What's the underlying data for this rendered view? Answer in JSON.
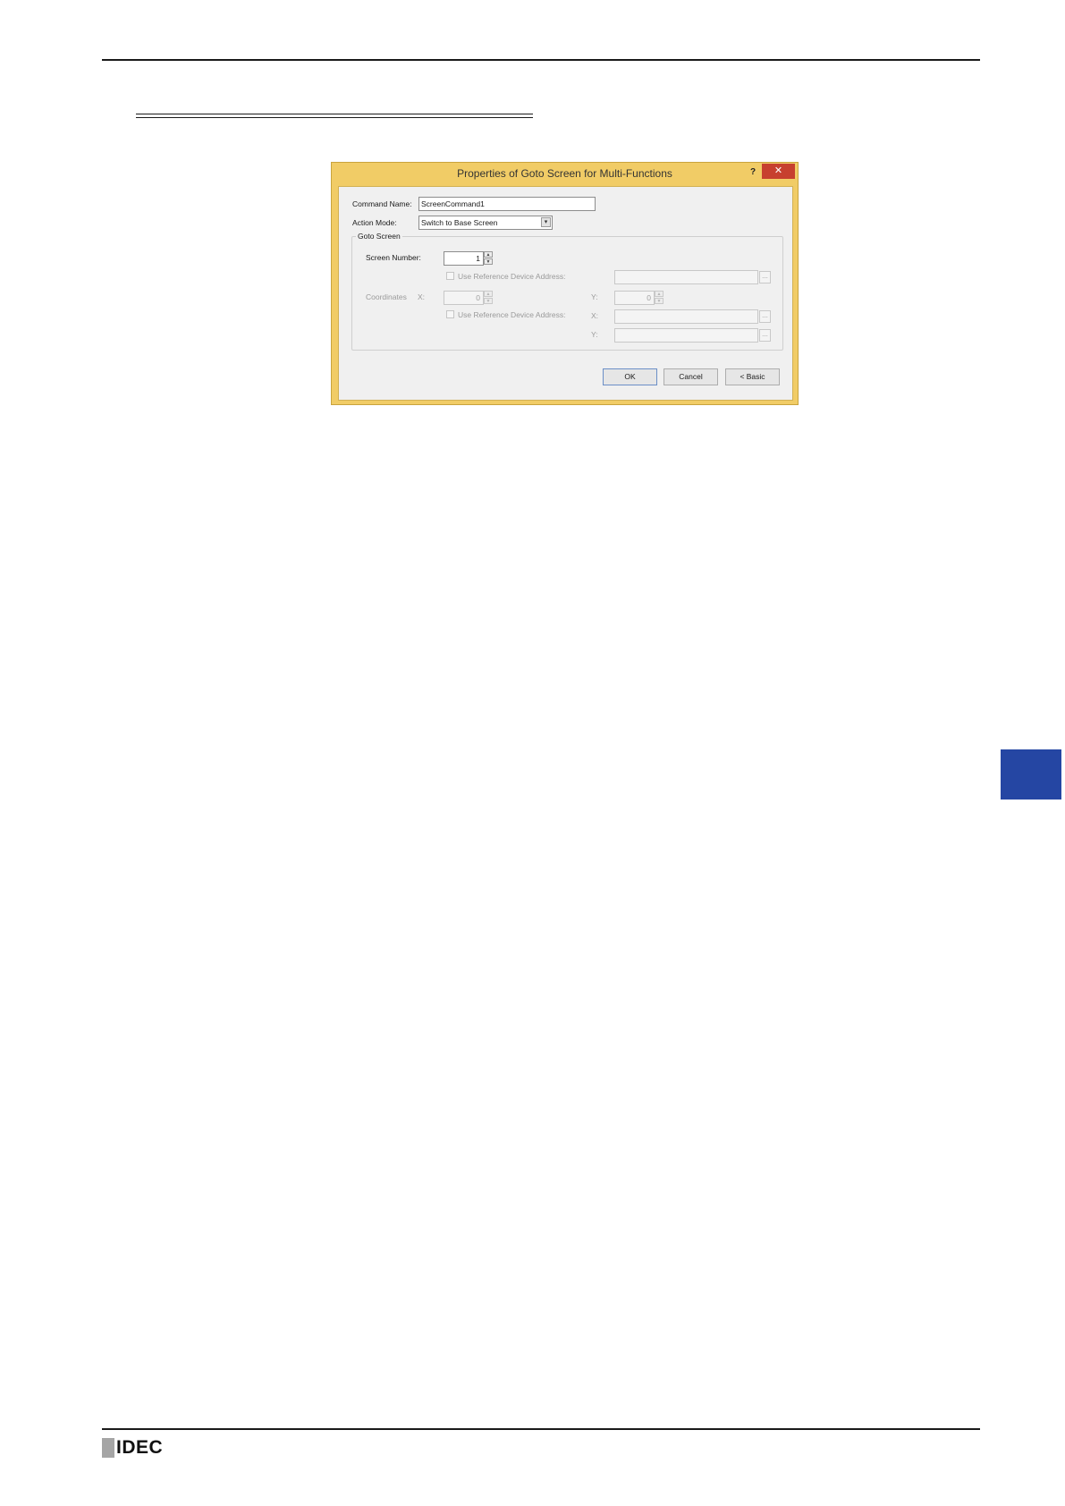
{
  "dialog": {
    "title": "Properties of Goto Screen for Multi-Functions",
    "help_glyph": "?",
    "close_glyph": "✕",
    "command_name_label": "Command Name:",
    "command_name_value": "ScreenCommand1",
    "action_mode_label": "Action Mode:",
    "action_mode_value": "Switch to Base Screen",
    "group_caption": "Goto Screen",
    "screen_number_label": "Screen Number:",
    "screen_number_value": "1",
    "use_ref_label_1": "Use Reference Device Address:",
    "coordinates_label": "Coordinates",
    "x_label": "X:",
    "y_label": "Y:",
    "x_value": "0",
    "y_value": "0",
    "use_ref_label_2": "Use Reference Device Address:",
    "ref_x_label": "X:",
    "ref_y_label": "Y:",
    "ellipsis": "...",
    "ok_label": "OK",
    "cancel_label": "Cancel",
    "basic_label": "< Basic"
  },
  "footer": {
    "logo_text": "IDEC"
  },
  "colors": {
    "side_tab": "#2546a3",
    "dialog_frame": "#f1cc66",
    "close_button": "#c7402f"
  }
}
